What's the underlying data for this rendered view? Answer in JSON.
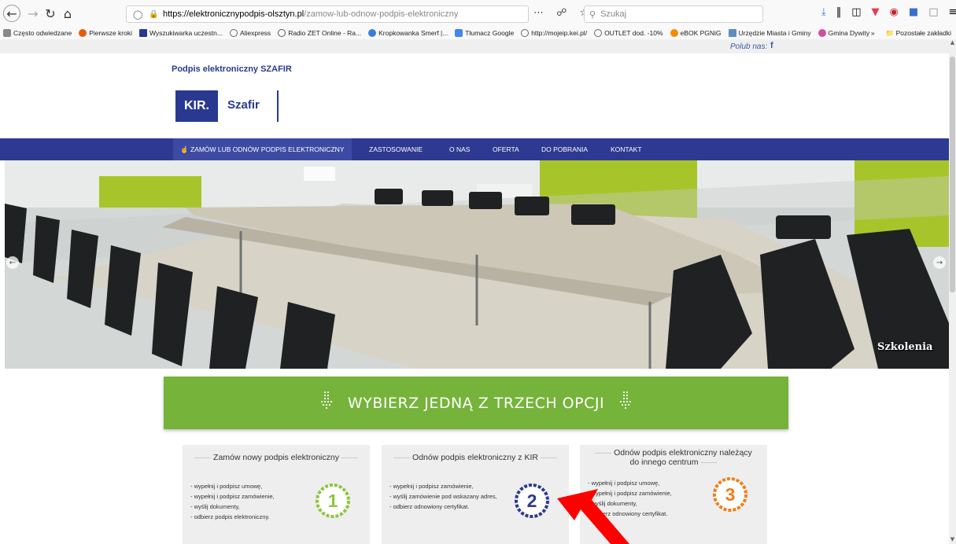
{
  "browser": {
    "url_host": "https://elektronicznypodpis-olsztyn.pl",
    "url_path": "/zamow-lub-odnow-podpis-elektroniczny",
    "search_placeholder": "Szukaj",
    "bookmarks": [
      {
        "label": "Często odwiedzane",
        "color": "#888888"
      },
      {
        "label": "Pierwsze kroki",
        "color": "#e66000"
      },
      {
        "label": "Wyszukiwarka uczestn...",
        "color": "#2a3990"
      },
      {
        "label": "Aliexpress",
        "color": "#666666"
      },
      {
        "label": "Radio ZET Online - Ra...",
        "color": "#555555"
      },
      {
        "label": "Kropkowanka Smerf |...",
        "color": "#3b7dd8"
      },
      {
        "label": "Tłumacz Google",
        "color": "#4285f4"
      },
      {
        "label": "http://mojeip.kei.pl/",
        "color": "#666666"
      },
      {
        "label": "OUTLET dod. -10%",
        "color": "#666666"
      },
      {
        "label": "eBOK PGNiG",
        "color": "#f28c00"
      },
      {
        "label": "Urzędzie Miasta i Gminy",
        "color": "#5b8fbf"
      },
      {
        "label": "Gmina Dywity",
        "color": "#d050a0"
      }
    ],
    "other_bookmarks": "Pozostałe zakładki"
  },
  "header": {
    "like_us": "Polub nas:",
    "fb": "f",
    "site_title": "Podpis elektroniczny SZAFIR",
    "logo_kir": "KIR.",
    "logo_szafir": "Szafir"
  },
  "nav": {
    "items": [
      "ZAMÓW LUB ODNÓW PODPIS ELEKTRONICZNY",
      "ZASTOSOWANIE",
      "O NAS",
      "OFERTA",
      "DO POBRANIA",
      "KONTAKT"
    ]
  },
  "hero": {
    "caption": "Szkolenia"
  },
  "banner": {
    "text": "WYBIERZ JEDNĄ Z TRZECH OPCJI"
  },
  "options": [
    {
      "title": "Zamów nowy podpis elektroniczny",
      "number": "1",
      "color": "#8dc63f",
      "items": [
        "- wypełnij i podpisz umowę,",
        "- wypełnij i podpisz zamówienie,",
        "- wyślij dokumenty,",
        "- odbierz podpis elektroniczny."
      ]
    },
    {
      "title": "Odnów podpis elektroniczny z KIR",
      "number": "2",
      "color": "#2e3991",
      "items": [
        "- wypełnij i podpisz zamówienie,",
        "- wyślij zamówienie pod wskazany adres,",
        "- odbierz odnowiony certyfikat."
      ]
    },
    {
      "title": "Odnów podpis elektroniczny należący do innego centrum",
      "number": "3",
      "color": "#f07f1a",
      "items": [
        "- wypełnij i podpisz umowę,",
        "- wypełnij i podpisz zamówienie,",
        "- wyślij dokumenty,",
        "- odbierz odnowiony certyfikat."
      ]
    }
  ],
  "colors": {
    "nav_bg": "#2e3991",
    "banner_bg": "#75b33a",
    "annotation_arrow": "#ff0000"
  }
}
